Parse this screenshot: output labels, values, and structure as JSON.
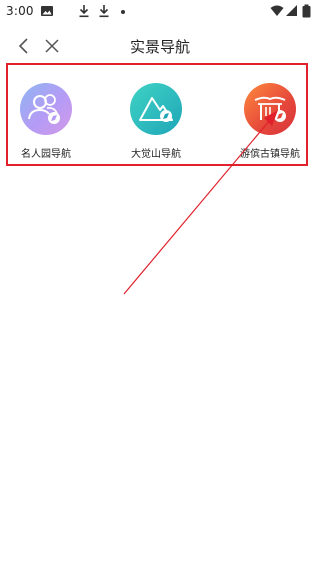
{
  "status_bar": {
    "time": "3:00",
    "icons": [
      "image-icon",
      "download-icon",
      "download-icon",
      "notification-dot",
      "wifi-icon",
      "signal-icon",
      "battery-icon"
    ]
  },
  "header": {
    "title": "实景导航",
    "back_icon": "chevron-left-icon",
    "close_icon": "close-icon"
  },
  "navigation_items": [
    {
      "label": "名人园导航",
      "icon": "people-icon",
      "color": "#b79df5"
    },
    {
      "label": "大觉山导航",
      "icon": "mountain-icon",
      "color": "#2fbfc0"
    },
    {
      "label": "游傧古镇导航",
      "icon": "gate-icon",
      "color": "#e8603a"
    }
  ],
  "annotation": {
    "color": "#e0202a"
  }
}
